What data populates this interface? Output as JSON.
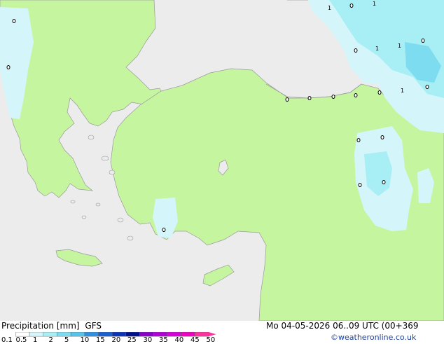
{
  "map": {
    "product_label": "Precipitation [mm]",
    "model": "GFS",
    "valid_time": "Mo 04-05-2026 06..09 UTC (00+369",
    "credit": "©weatheronline.co.uk",
    "land_color": "#c6f5a0",
    "sea_color": "#ececec",
    "precip_light_color": "#d4f6fa",
    "precip_med_color": "#a7eef5",
    "precip_heavy_color": "#7edcf0",
    "coast_color": "#9a9a9a",
    "marker_labels": [
      "1",
      "1",
      "1",
      "1",
      "1"
    ],
    "legend": {
      "ticks": [
        "0.1",
        "0.5",
        "1",
        "2",
        "5",
        "10",
        "15",
        "20",
        "25",
        "30",
        "35",
        "40",
        "45",
        "50"
      ],
      "colors": [
        "#ffffff",
        "#d4f6fa",
        "#a7eef5",
        "#7edcf0",
        "#55c4ea",
        "#2f8fe0",
        "#1a5fd0",
        "#0a35b8",
        "#00108a",
        "#8a00c8",
        "#b000d8",
        "#d800d8",
        "#f000c0",
        "#ff30a0"
      ]
    }
  }
}
